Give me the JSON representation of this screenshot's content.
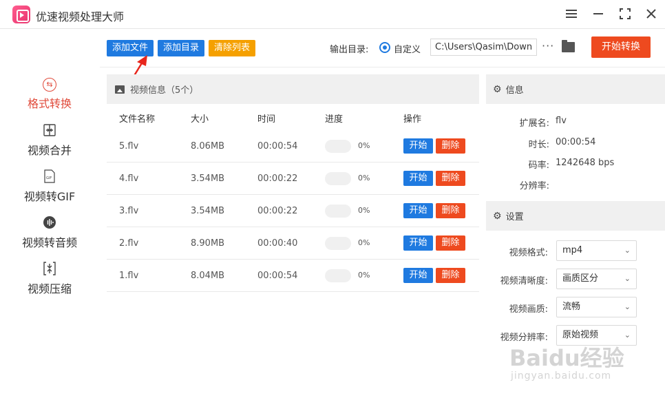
{
  "app": {
    "title": "优速视频处理大师"
  },
  "sidebar": {
    "items": [
      {
        "label": "格式转换",
        "icon": "swap-icon"
      },
      {
        "label": "视频合并",
        "icon": "merge-icon"
      },
      {
        "label": "视频转GIF",
        "icon": "gif-icon"
      },
      {
        "label": "视频转音频",
        "icon": "audio-wave-icon"
      },
      {
        "label": "视频压缩",
        "icon": "compress-icon"
      }
    ],
    "active_index": 0
  },
  "toolbar": {
    "add_file": "添加文件",
    "add_dir": "添加目录",
    "clear_list": "清除列表",
    "output_label": "输出目录:",
    "custom_label": "自定义",
    "output_path": "C:\\Users\\Qasim\\Downlo",
    "more": "···",
    "start_convert": "开始转换"
  },
  "colors": {
    "blue": "#1f7ae0",
    "orange": "#f5a000",
    "red": "#ee4a1f"
  },
  "list": {
    "title": "视频信息（5个）",
    "headers": {
      "name": "文件名称",
      "size": "大小",
      "time": "时间",
      "progress": "进度",
      "ops": "操作"
    },
    "rows": [
      {
        "name": "5.flv",
        "size": "8.06MB",
        "time": "00:00:54",
        "progress": 0,
        "progress_label": "0%",
        "start": "开始",
        "delete": "删除"
      },
      {
        "name": "4.flv",
        "size": "3.54MB",
        "time": "00:00:22",
        "progress": 0,
        "progress_label": "0%",
        "start": "开始",
        "delete": "删除"
      },
      {
        "name": "3.flv",
        "size": "3.54MB",
        "time": "00:00:22",
        "progress": 0,
        "progress_label": "0%",
        "start": "开始",
        "delete": "删除"
      },
      {
        "name": "2.flv",
        "size": "8.90MB",
        "time": "00:00:40",
        "progress": 0,
        "progress_label": "0%",
        "start": "开始",
        "delete": "删除"
      },
      {
        "name": "1.flv",
        "size": "8.04MB",
        "time": "00:00:54",
        "progress": 0,
        "progress_label": "0%",
        "start": "开始",
        "delete": "删除"
      }
    ]
  },
  "info": {
    "title": "信息",
    "ext_label": "扩展名:",
    "ext": "flv",
    "duration_label": "时长:",
    "duration": "00:00:54",
    "bitrate_label": "码率:",
    "bitrate": "1242648 bps",
    "resolution_label": "分辨率:",
    "resolution": ""
  },
  "settings": {
    "title": "设置",
    "format_label": "视频格式:",
    "format": "mp4",
    "clarity_label": "视频清晰度:",
    "clarity": "画质区分",
    "quality_label": "视频画质:",
    "quality": "流畅",
    "resolution_label": "视频分辨率:",
    "resolution": "原始视频"
  },
  "watermark": {
    "logo": "Baidu经验",
    "url": "jingyan.baidu.com"
  }
}
